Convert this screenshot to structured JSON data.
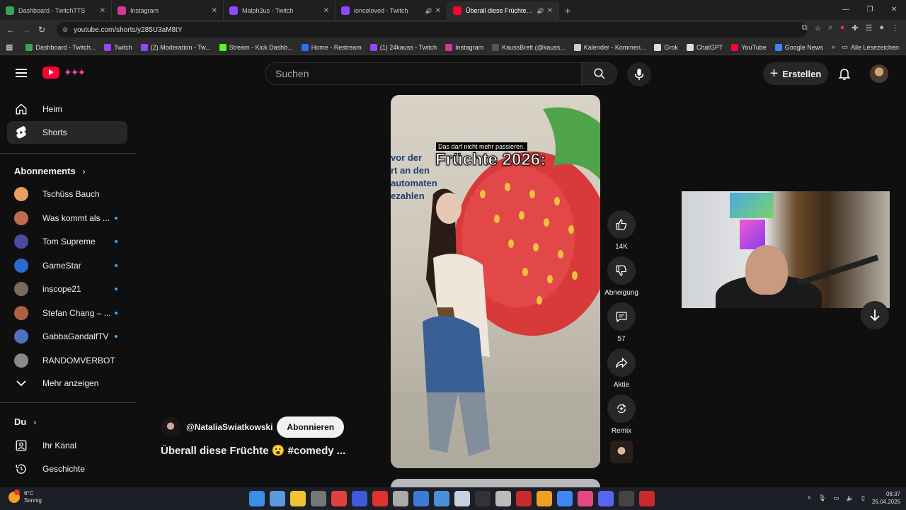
{
  "browser": {
    "tabs": [
      {
        "label": "Dashboard - TwitchTTS",
        "color": "#3aa35a",
        "active": false,
        "audio": false
      },
      {
        "label": "Instagram",
        "color": "#d6369a",
        "active": false,
        "audio": false
      },
      {
        "label": "Malph3us - Twitch",
        "color": "#9146ff",
        "active": false,
        "audio": false
      },
      {
        "label": "ionceloved - Twitch",
        "color": "#9146ff",
        "active": false,
        "audio": true
      },
      {
        "label": "Überall diese Früchte 😮 #c",
        "color": "#ff0033",
        "active": true,
        "audio": true
      }
    ],
    "url": "youtube.com/shorts/y285U3aM8tY",
    "bookmarks": [
      {
        "label": "Dashboard - Twitch...",
        "color": "#3aa35a"
      },
      {
        "label": "Twitch",
        "color": "#9146ff"
      },
      {
        "label": "(2) Moderation - Tw...",
        "color": "#9146ff"
      },
      {
        "label": "Stream - Kick Dashb...",
        "color": "#53fc18"
      },
      {
        "label": "Home - Restream",
        "color": "#2f6bff"
      },
      {
        "label": "(1) 24kauss - Twitch",
        "color": "#9146ff"
      },
      {
        "label": "Instagram",
        "color": "#d6369a"
      },
      {
        "label": "KaussBrett (@kauss...",
        "color": "#555555"
      },
      {
        "label": "Kalender - Kommen...",
        "color": "#cccccc"
      },
      {
        "label": "Grok",
        "color": "#dddddd"
      },
      {
        "label": "ChatGPT",
        "color": "#dddddd"
      },
      {
        "label": "YouTube",
        "color": "#ff0033"
      },
      {
        "label": "Google News",
        "color": "#4285f4"
      }
    ],
    "all_bookmarks": "Alle Lesezeichen"
  },
  "youtube": {
    "search_placeholder": "Suchen",
    "create_label": "Erstellen",
    "sidebar": {
      "home": "Heim",
      "shorts": "Shorts",
      "subscriptions_header": "Abonnements",
      "subscriptions": [
        {
          "name": "Tschüss Bauch",
          "color": "#e8a060",
          "new": false
        },
        {
          "name": "Was kommt als ...",
          "color": "#c06a50",
          "new": true
        },
        {
          "name": "Tom Supreme",
          "color": "#4a4aa0",
          "new": true
        },
        {
          "name": "GameStar",
          "color": "#2a6ad0",
          "new": true
        },
        {
          "name": "inscope21",
          "color": "#7a6a5a",
          "new": true
        },
        {
          "name": "Stefan Chang – ...",
          "color": "#b06040",
          "new": true
        },
        {
          "name": "GabbaGandalfTV",
          "color": "#5070c0",
          "new": true
        },
        {
          "name": "RANDOMVERBOT",
          "color": "#8a8a8a",
          "new": false
        }
      ],
      "show_more": "Mehr anzeigen",
      "you_header": "Du",
      "channel": "Ihr Kanal",
      "history": "Geschichte"
    },
    "short": {
      "wall_text": "vor der\nrt an den\nautomaten\nezahlen",
      "caption_small": "Das darf nicht mehr passieren.",
      "caption_big": "Früchte 2026:",
      "channel": "@NataliaSwiatkowski",
      "subscribe": "Abonnieren",
      "title": "Überall diese Früchte 😮 #comedy  ..."
    },
    "actions": {
      "likes": "14K",
      "dislike": "Abneigung",
      "comments": "57",
      "share": "Aktie",
      "remix": "Remix"
    }
  },
  "taskbar": {
    "temp": "6°C",
    "weather": "Sonnig",
    "time": "08:37",
    "date": "26.04.2026",
    "icon_colors": [
      "#3a8ee6",
      "#5a9adf",
      "#f1c232",
      "#777777",
      "#e04040",
      "#3b5bdb",
      "#e03131",
      "#aaaaaa",
      "#3a7bd5",
      "#4a90d9",
      "#c7d2e0",
      "#333333",
      "#bbbbbb",
      "#c92a2a",
      "#f0a020",
      "#4285f4",
      "#e64980",
      "#5865f2",
      "#444444",
      "#c92a2a"
    ]
  }
}
